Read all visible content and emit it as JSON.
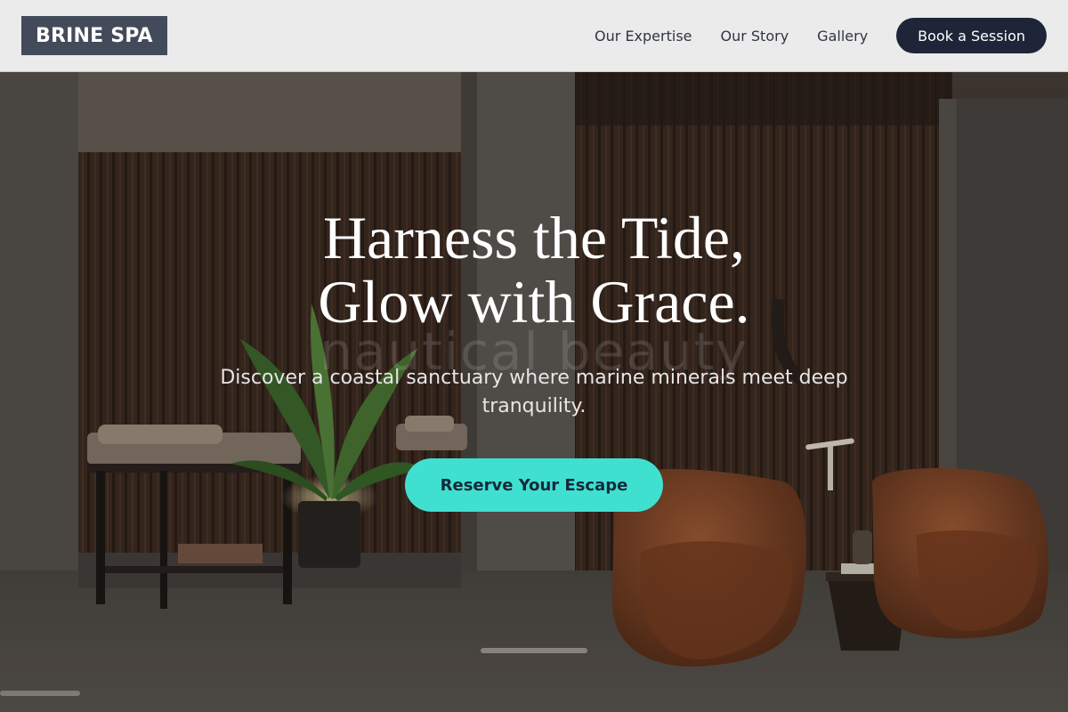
{
  "header": {
    "logo_text": "BRINE SPA",
    "nav": [
      {
        "label": "Our Expertise"
      },
      {
        "label": "Our Story"
      },
      {
        "label": "Gallery"
      }
    ],
    "cta_label": "Book a Session"
  },
  "hero": {
    "headline_line1": "Harness the Tide,",
    "headline_line2": "Glow with Grace.",
    "subtitle": "Discover a coastal sanctuary where marine minerals meet deep tranquility.",
    "watermark_text": "nautical beauty",
    "cta_label": "Reserve Your Escape"
  },
  "colors": {
    "header_bg": "#ebebeb",
    "logo_bg": "#434a5a",
    "nav_cta_bg": "#1e2538",
    "hero_cta_bg": "#40e0d0",
    "hero_cta_text": "#17283b"
  }
}
